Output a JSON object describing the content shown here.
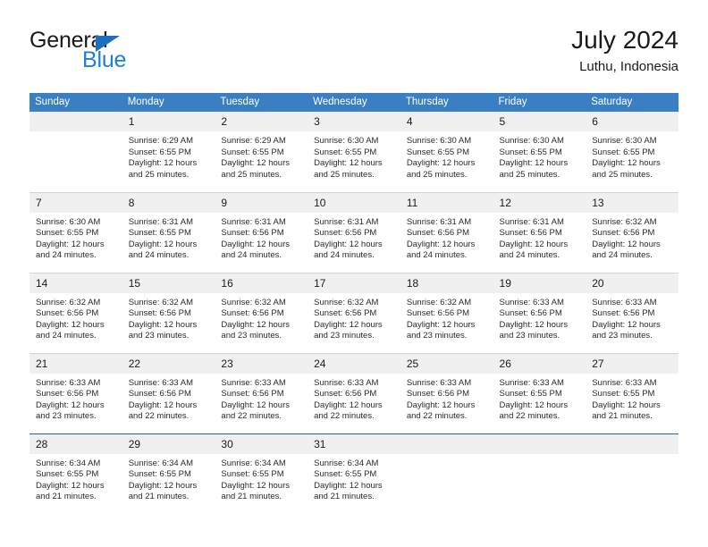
{
  "brand": {
    "name_top": "General",
    "name_bottom": "Blue",
    "accent_color": "#1f7fd1",
    "triangle_color": "#1b6ec2"
  },
  "header": {
    "title": "July 2024",
    "subtitle": "Luthu, Indonesia"
  },
  "theme": {
    "header_row_background": "#3a7fc1",
    "header_row_text": "#ffffff",
    "daynum_background": "#f0f0f0",
    "row_divider": "#d4d4d4",
    "last_row_divider": "#2166a8"
  },
  "weekday_headers": [
    "Sunday",
    "Monday",
    "Tuesday",
    "Wednesday",
    "Thursday",
    "Friday",
    "Saturday"
  ],
  "labels": {
    "sunrise_prefix": "Sunrise:",
    "sunset_prefix": "Sunset:",
    "daylight_prefix": "Daylight:"
  },
  "weeks": [
    [
      {
        "day": "",
        "sunrise": "",
        "sunset": "",
        "daylight_line1": "",
        "daylight_line2": "",
        "blank": true
      },
      {
        "day": "1",
        "sunrise": "Sunrise: 6:29 AM",
        "sunset": "Sunset: 6:55 PM",
        "daylight_line1": "Daylight: 12 hours",
        "daylight_line2": "and 25 minutes.",
        "blank": false
      },
      {
        "day": "2",
        "sunrise": "Sunrise: 6:29 AM",
        "sunset": "Sunset: 6:55 PM",
        "daylight_line1": "Daylight: 12 hours",
        "daylight_line2": "and 25 minutes.",
        "blank": false
      },
      {
        "day": "3",
        "sunrise": "Sunrise: 6:30 AM",
        "sunset": "Sunset: 6:55 PM",
        "daylight_line1": "Daylight: 12 hours",
        "daylight_line2": "and 25 minutes.",
        "blank": false
      },
      {
        "day": "4",
        "sunrise": "Sunrise: 6:30 AM",
        "sunset": "Sunset: 6:55 PM",
        "daylight_line1": "Daylight: 12 hours",
        "daylight_line2": "and 25 minutes.",
        "blank": false
      },
      {
        "day": "5",
        "sunrise": "Sunrise: 6:30 AM",
        "sunset": "Sunset: 6:55 PM",
        "daylight_line1": "Daylight: 12 hours",
        "daylight_line2": "and 25 minutes.",
        "blank": false
      },
      {
        "day": "6",
        "sunrise": "Sunrise: 6:30 AM",
        "sunset": "Sunset: 6:55 PM",
        "daylight_line1": "Daylight: 12 hours",
        "daylight_line2": "and 25 minutes.",
        "blank": false
      }
    ],
    [
      {
        "day": "7",
        "sunrise": "Sunrise: 6:30 AM",
        "sunset": "Sunset: 6:55 PM",
        "daylight_line1": "Daylight: 12 hours",
        "daylight_line2": "and 24 minutes.",
        "blank": false
      },
      {
        "day": "8",
        "sunrise": "Sunrise: 6:31 AM",
        "sunset": "Sunset: 6:55 PM",
        "daylight_line1": "Daylight: 12 hours",
        "daylight_line2": "and 24 minutes.",
        "blank": false
      },
      {
        "day": "9",
        "sunrise": "Sunrise: 6:31 AM",
        "sunset": "Sunset: 6:56 PM",
        "daylight_line1": "Daylight: 12 hours",
        "daylight_line2": "and 24 minutes.",
        "blank": false
      },
      {
        "day": "10",
        "sunrise": "Sunrise: 6:31 AM",
        "sunset": "Sunset: 6:56 PM",
        "daylight_line1": "Daylight: 12 hours",
        "daylight_line2": "and 24 minutes.",
        "blank": false
      },
      {
        "day": "11",
        "sunrise": "Sunrise: 6:31 AM",
        "sunset": "Sunset: 6:56 PM",
        "daylight_line1": "Daylight: 12 hours",
        "daylight_line2": "and 24 minutes.",
        "blank": false
      },
      {
        "day": "12",
        "sunrise": "Sunrise: 6:31 AM",
        "sunset": "Sunset: 6:56 PM",
        "daylight_line1": "Daylight: 12 hours",
        "daylight_line2": "and 24 minutes.",
        "blank": false
      },
      {
        "day": "13",
        "sunrise": "Sunrise: 6:32 AM",
        "sunset": "Sunset: 6:56 PM",
        "daylight_line1": "Daylight: 12 hours",
        "daylight_line2": "and 24 minutes.",
        "blank": false
      }
    ],
    [
      {
        "day": "14",
        "sunrise": "Sunrise: 6:32 AM",
        "sunset": "Sunset: 6:56 PM",
        "daylight_line1": "Daylight: 12 hours",
        "daylight_line2": "and 24 minutes.",
        "blank": false
      },
      {
        "day": "15",
        "sunrise": "Sunrise: 6:32 AM",
        "sunset": "Sunset: 6:56 PM",
        "daylight_line1": "Daylight: 12 hours",
        "daylight_line2": "and 23 minutes.",
        "blank": false
      },
      {
        "day": "16",
        "sunrise": "Sunrise: 6:32 AM",
        "sunset": "Sunset: 6:56 PM",
        "daylight_line1": "Daylight: 12 hours",
        "daylight_line2": "and 23 minutes.",
        "blank": false
      },
      {
        "day": "17",
        "sunrise": "Sunrise: 6:32 AM",
        "sunset": "Sunset: 6:56 PM",
        "daylight_line1": "Daylight: 12 hours",
        "daylight_line2": "and 23 minutes.",
        "blank": false
      },
      {
        "day": "18",
        "sunrise": "Sunrise: 6:32 AM",
        "sunset": "Sunset: 6:56 PM",
        "daylight_line1": "Daylight: 12 hours",
        "daylight_line2": "and 23 minutes.",
        "blank": false
      },
      {
        "day": "19",
        "sunrise": "Sunrise: 6:33 AM",
        "sunset": "Sunset: 6:56 PM",
        "daylight_line1": "Daylight: 12 hours",
        "daylight_line2": "and 23 minutes.",
        "blank": false
      },
      {
        "day": "20",
        "sunrise": "Sunrise: 6:33 AM",
        "sunset": "Sunset: 6:56 PM",
        "daylight_line1": "Daylight: 12 hours",
        "daylight_line2": "and 23 minutes.",
        "blank": false
      }
    ],
    [
      {
        "day": "21",
        "sunrise": "Sunrise: 6:33 AM",
        "sunset": "Sunset: 6:56 PM",
        "daylight_line1": "Daylight: 12 hours",
        "daylight_line2": "and 23 minutes.",
        "blank": false
      },
      {
        "day": "22",
        "sunrise": "Sunrise: 6:33 AM",
        "sunset": "Sunset: 6:56 PM",
        "daylight_line1": "Daylight: 12 hours",
        "daylight_line2": "and 22 minutes.",
        "blank": false
      },
      {
        "day": "23",
        "sunrise": "Sunrise: 6:33 AM",
        "sunset": "Sunset: 6:56 PM",
        "daylight_line1": "Daylight: 12 hours",
        "daylight_line2": "and 22 minutes.",
        "blank": false
      },
      {
        "day": "24",
        "sunrise": "Sunrise: 6:33 AM",
        "sunset": "Sunset: 6:56 PM",
        "daylight_line1": "Daylight: 12 hours",
        "daylight_line2": "and 22 minutes.",
        "blank": false
      },
      {
        "day": "25",
        "sunrise": "Sunrise: 6:33 AM",
        "sunset": "Sunset: 6:56 PM",
        "daylight_line1": "Daylight: 12 hours",
        "daylight_line2": "and 22 minutes.",
        "blank": false
      },
      {
        "day": "26",
        "sunrise": "Sunrise: 6:33 AM",
        "sunset": "Sunset: 6:55 PM",
        "daylight_line1": "Daylight: 12 hours",
        "daylight_line2": "and 22 minutes.",
        "blank": false
      },
      {
        "day": "27",
        "sunrise": "Sunrise: 6:33 AM",
        "sunset": "Sunset: 6:55 PM",
        "daylight_line1": "Daylight: 12 hours",
        "daylight_line2": "and 21 minutes.",
        "blank": false
      }
    ],
    [
      {
        "day": "28",
        "sunrise": "Sunrise: 6:34 AM",
        "sunset": "Sunset: 6:55 PM",
        "daylight_line1": "Daylight: 12 hours",
        "daylight_line2": "and 21 minutes.",
        "blank": false
      },
      {
        "day": "29",
        "sunrise": "Sunrise: 6:34 AM",
        "sunset": "Sunset: 6:55 PM",
        "daylight_line1": "Daylight: 12 hours",
        "daylight_line2": "and 21 minutes.",
        "blank": false
      },
      {
        "day": "30",
        "sunrise": "Sunrise: 6:34 AM",
        "sunset": "Sunset: 6:55 PM",
        "daylight_line1": "Daylight: 12 hours",
        "daylight_line2": "and 21 minutes.",
        "blank": false
      },
      {
        "day": "31",
        "sunrise": "Sunrise: 6:34 AM",
        "sunset": "Sunset: 6:55 PM",
        "daylight_line1": "Daylight: 12 hours",
        "daylight_line2": "and 21 minutes.",
        "blank": false
      },
      {
        "day": "",
        "sunrise": "",
        "sunset": "",
        "daylight_line1": "",
        "daylight_line2": "",
        "blank": true
      },
      {
        "day": "",
        "sunrise": "",
        "sunset": "",
        "daylight_line1": "",
        "daylight_line2": "",
        "blank": true
      },
      {
        "day": "",
        "sunrise": "",
        "sunset": "",
        "daylight_line1": "",
        "daylight_line2": "",
        "blank": true
      }
    ]
  ]
}
